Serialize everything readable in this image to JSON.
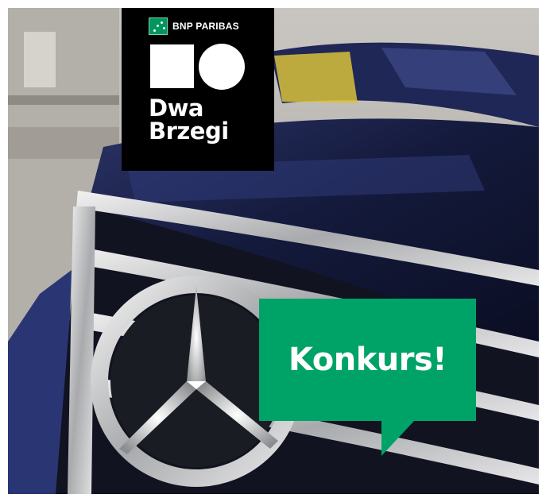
{
  "brand": {
    "bank_name": "BNP PARIBAS",
    "title_line1": "Dwa",
    "title_line2": "Brzegi"
  },
  "badge": {
    "text": "Konkurs!"
  },
  "colors": {
    "bnp_green": "#00965e",
    "bubble_green": "#00a367",
    "logo_box": "#000000",
    "car_paint": "#1c2148"
  },
  "icons": {
    "bank_logo": "bnp-stars-icon",
    "square": "square-shape-icon",
    "circle": "circle-shape-icon"
  }
}
